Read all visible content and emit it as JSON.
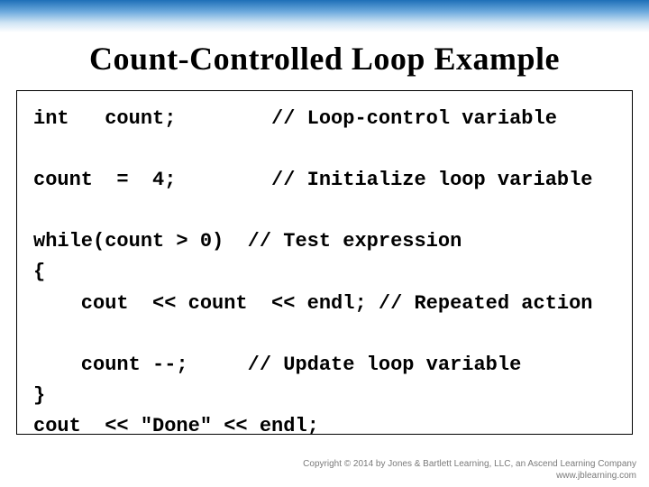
{
  "title": "Count-Controlled Loop Example",
  "code": {
    "l1": "int   count;        // Loop-control variable",
    "l2": "",
    "l3": "count  =  4;        // Initialize loop variable",
    "l4": "",
    "l5": "while(count > 0)  // Test expression",
    "l6": "{",
    "l7": "    cout  << count  << endl; // Repeated action",
    "l8": "",
    "l9": "    count --;     // Update loop variable",
    "l10": "}",
    "l11": "cout  << \"Done\" << endl;"
  },
  "footer": {
    "line1": "Copyright © 2014 by Jones & Bartlett Learning, LLC, an Ascend Learning Company",
    "line2": "www.jblearning.com"
  }
}
